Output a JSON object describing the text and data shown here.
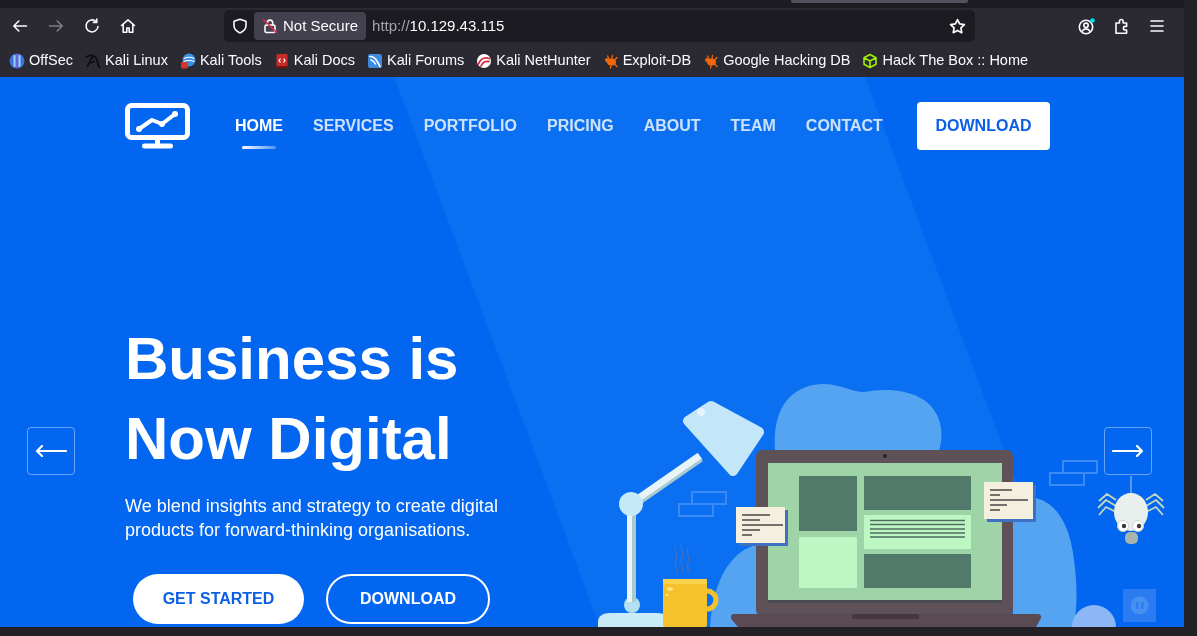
{
  "browser": {
    "forward_disabled": true,
    "security_label": "Not Secure",
    "url": {
      "scheme": "http://",
      "host": "10.129.43.115"
    },
    "bookmarks": [
      {
        "label": "OffSec"
      },
      {
        "label": "Kali Linux"
      },
      {
        "label": "Kali Tools"
      },
      {
        "label": "Kali Docs"
      },
      {
        "label": "Kali Forums"
      },
      {
        "label": "Kali NetHunter"
      },
      {
        "label": "Exploit-DB"
      },
      {
        "label": "Google Hacking DB"
      },
      {
        "label": "Hack The Box :: Home"
      }
    ]
  },
  "nav": {
    "items": [
      {
        "label": "HOME",
        "selected": true
      },
      {
        "label": "SERVICES",
        "selected": false
      },
      {
        "label": "PORTFOLIO",
        "selected": false
      },
      {
        "label": "PRICING",
        "selected": false
      },
      {
        "label": "ABOUT",
        "selected": false
      },
      {
        "label": "TEAM",
        "selected": false
      },
      {
        "label": "CONTACT",
        "selected": false
      }
    ],
    "cta": "DOWNLOAD"
  },
  "hero": {
    "title": "Business is Now Digital",
    "description": "We blend insights and strategy to create digital products for forward-thinking organisations.",
    "buttons": [
      {
        "label": "GET STARTED",
        "kind": "filled"
      },
      {
        "label": "DOWNLOAD",
        "kind": "outline"
      }
    ]
  }
}
